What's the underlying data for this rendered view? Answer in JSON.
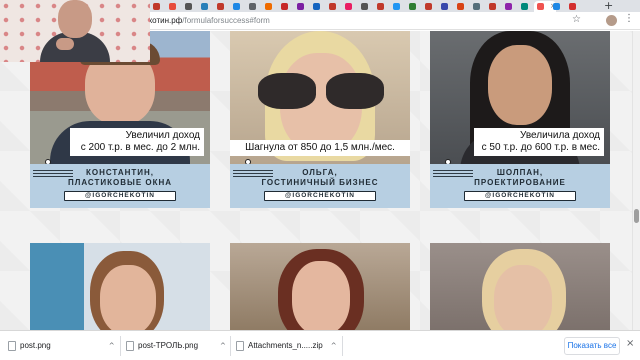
{
  "browser": {
    "url_host": "ехотин.рф",
    "url_path": "/formulaforsuccess#form",
    "tab_close": "×",
    "new_tab": "+",
    "star_icon": "star-icon",
    "menu_icon": "⋮",
    "tab_colors": [
      "#c0392b",
      "#e74c3c",
      "#555",
      "#2980b9",
      "#c0392b",
      "#1e88e5",
      "#5f6368",
      "#ef6c00",
      "#c62828",
      "#7b1fa2",
      "#1565c0",
      "#c0392b",
      "#e91e63",
      "#555",
      "#c0392b",
      "#2196f3",
      "#2e7d32",
      "#c0392b",
      "#3949ab",
      "#d84315",
      "#546e7a",
      "#c0392b",
      "#8e24aa",
      "#00897b",
      "#ef5350",
      "#1e88e5",
      "#d32f2f"
    ]
  },
  "cards": [
    {
      "quote_line1": "Увеличил доход",
      "quote_line2": "с 200 т.р. в мес. до 2 млн.",
      "name_line1": "КОНСТАНТИН,",
      "name_line2": "ПЛАСТИКОВЫЕ ОКНА",
      "handle": "@IGORCHEKOTIN"
    },
    {
      "quote_line1": "Шагнула от 850 до 1,5 млн./мес.",
      "quote_line2": "",
      "name_line1": "ОЛЬГА,",
      "name_line2": "ГОСТИНИЧНЫЙ БИЗНЕС",
      "handle": "@IGORCHEKOTIN"
    },
    {
      "quote_line1": "Увеличила доход",
      "quote_line2": "с 50 т.р. до 600 т.р. в мес.",
      "name_line1": "ШОЛПАН,",
      "name_line2": "ПРОЕКТИРОВАНИЕ",
      "handle": "@IGORCHEKOTIN"
    }
  ],
  "downloads": {
    "items": [
      {
        "name": "post.png"
      },
      {
        "name": "post-ТРОЛЬ.png"
      },
      {
        "name": "Attachments_n.....zip"
      }
    ],
    "caret": "^",
    "show_all": "Показать все",
    "close": "×"
  }
}
